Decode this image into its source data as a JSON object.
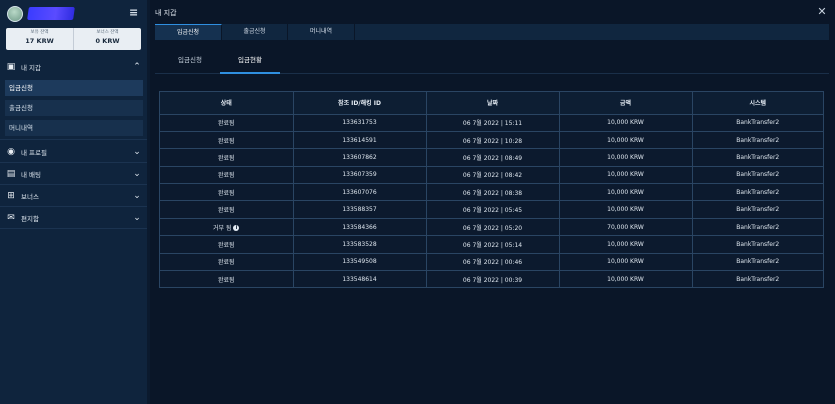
{
  "sidebar": {
    "balances": [
      {
        "label": "보유 잔액",
        "value": "17 KRW"
      },
      {
        "label": "보너스 잔액",
        "value": "0 KRW"
      }
    ],
    "wallet": {
      "label": "내 지갑"
    },
    "wallet_items": [
      {
        "label": "입금신청",
        "active": true
      },
      {
        "label": "출금신청",
        "active": false
      },
      {
        "label": "머니내역",
        "active": false
      }
    ],
    "sections": [
      {
        "label": "내 프로필",
        "icon": "profile-icon"
      },
      {
        "label": "내 배팅",
        "icon": "bet-slip-icon"
      },
      {
        "label": "보너스",
        "icon": "gift-icon"
      },
      {
        "label": "편지함",
        "icon": "mail-icon"
      }
    ]
  },
  "panel": {
    "title": "내 지갑",
    "top_tabs": [
      "입금신청",
      "출금신청",
      "머니내역"
    ],
    "sub_tabs": [
      "입금신청",
      "입금현황"
    ],
    "active_top_tab": 0,
    "active_sub_tab": 1
  },
  "table": {
    "headers": [
      "상태",
      "참조 ID/해킹 ID",
      "날짜",
      "금액",
      "시스템"
    ],
    "rows": [
      [
        "완료됨",
        "133631753",
        "06 7월 2022 | 15:11",
        "10,000 KRW",
        "BankTransfer2"
      ],
      [
        "완료됨",
        "133614591",
        "06 7월 2022 | 10:28",
        "10,000 KRW",
        "BankTransfer2"
      ],
      [
        "완료됨",
        "133607862",
        "06 7월 2022 | 08:49",
        "10,000 KRW",
        "BankTransfer2"
      ],
      [
        "완료됨",
        "133607359",
        "06 7월 2022 | 08:42",
        "10,000 KRW",
        "BankTransfer2"
      ],
      [
        "완료됨",
        "133607076",
        "06 7월 2022 | 08:38",
        "10,000 KRW",
        "BankTransfer2"
      ],
      [
        "완료됨",
        "133588357",
        "06 7월 2022 | 05:45",
        "10,000 KRW",
        "BankTransfer2"
      ],
      [
        "거부 됨",
        "133584366",
        "06 7월 2022 | 05:20",
        "70,000 KRW",
        "BankTransfer2"
      ],
      [
        "완료됨",
        "133583528",
        "06 7월 2022 | 05:14",
        "10,000 KRW",
        "BankTransfer2"
      ],
      [
        "완료됨",
        "133549508",
        "06 7월 2022 | 00:46",
        "10,000 KRW",
        "BankTransfer2"
      ],
      [
        "완료됨",
        "133548614",
        "06 7월 2022 | 00:39",
        "10,000 KRW",
        "BankTransfer2"
      ]
    ]
  },
  "colors": {
    "accent": "#2f8fe0",
    "background": "#0a1628",
    "sidebar": "#0f243d"
  }
}
